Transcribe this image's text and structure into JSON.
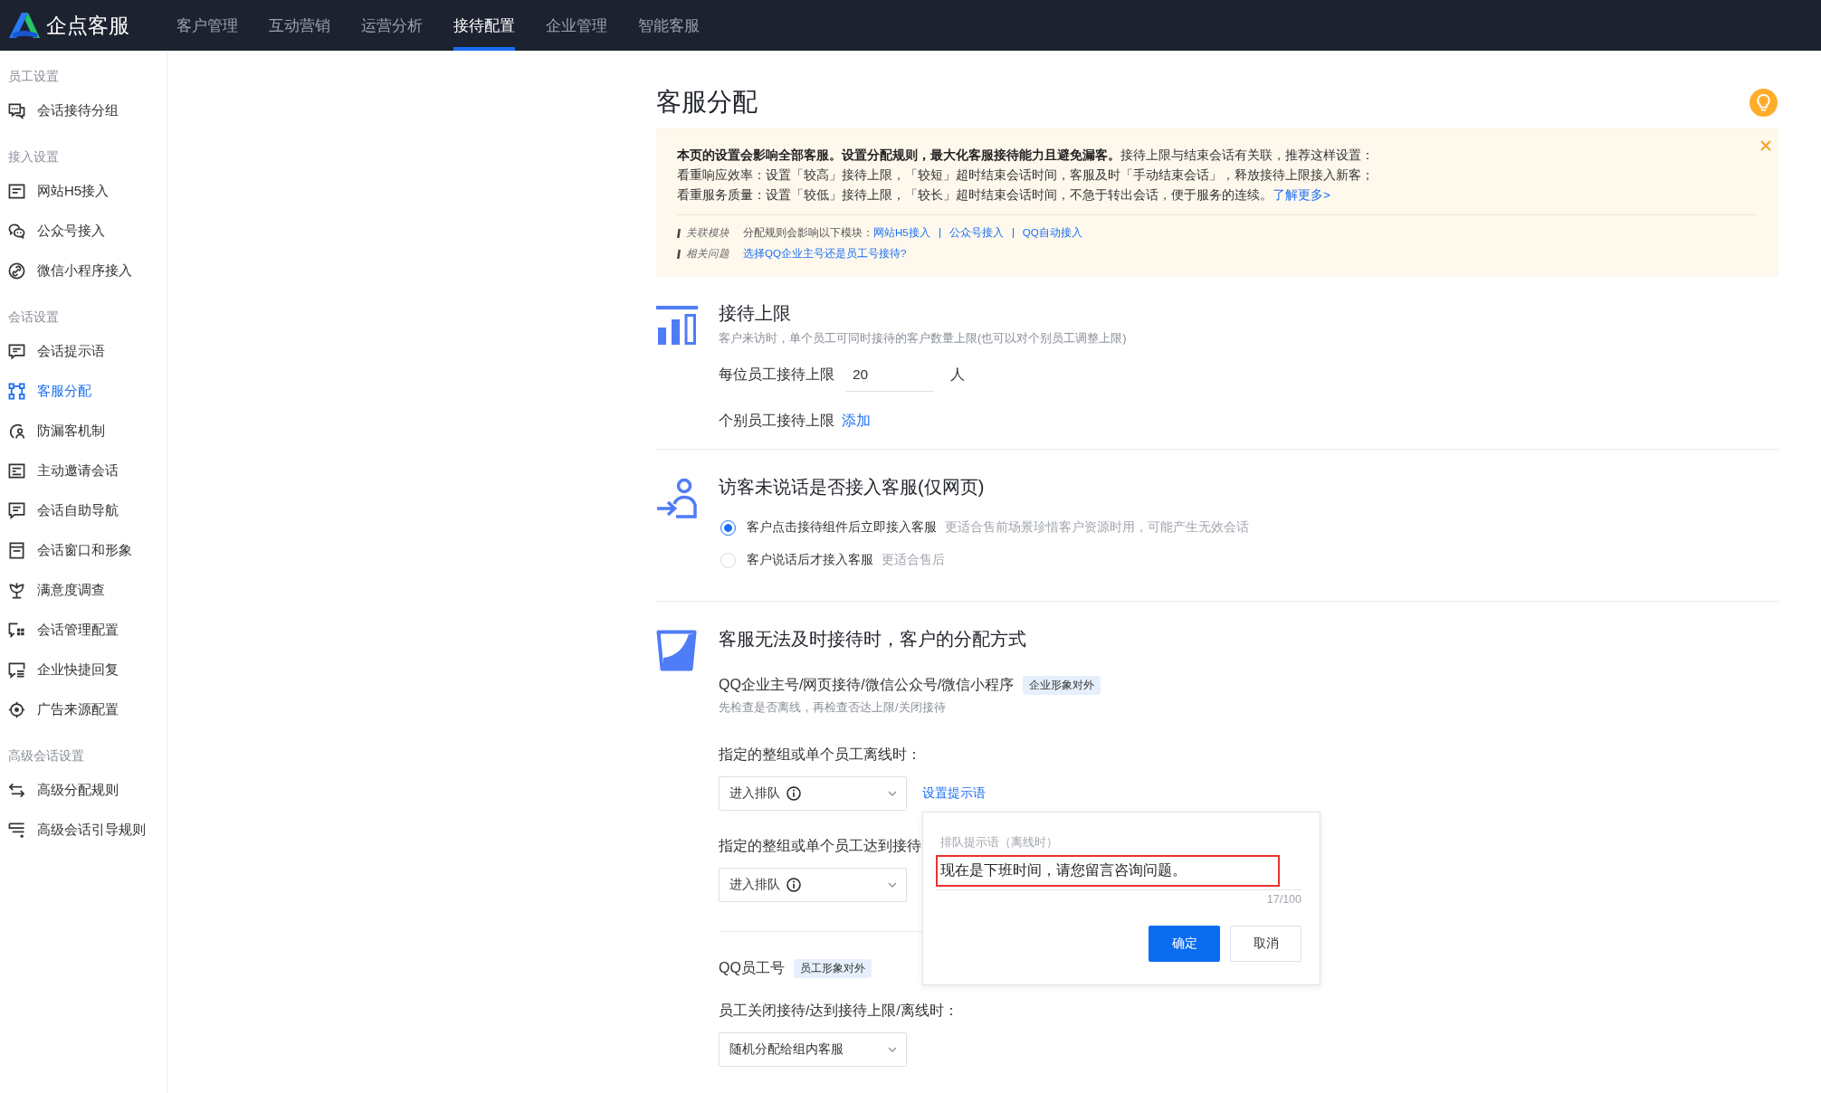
{
  "top_nav": {
    "logo_text": "企点客服",
    "items": [
      {
        "label": "客户管理",
        "selected": false
      },
      {
        "label": "互动营销",
        "selected": false
      },
      {
        "label": "运营分析",
        "selected": false
      },
      {
        "label": "接待配置",
        "selected": true
      },
      {
        "label": "企业管理",
        "selected": false
      },
      {
        "label": "智能客服",
        "selected": false
      }
    ]
  },
  "sidebar": {
    "groups": [
      {
        "title": "员工设置",
        "items": [
          {
            "label": "会话接待分组",
            "selected": false
          }
        ]
      },
      {
        "title": "接入设置",
        "items": [
          {
            "label": "网站H5接入",
            "selected": false
          },
          {
            "label": "公众号接入",
            "selected": false
          },
          {
            "label": "微信小程序接入",
            "selected": false
          }
        ]
      },
      {
        "title": "会话设置",
        "items": [
          {
            "label": "会话提示语",
            "selected": false
          },
          {
            "label": "客服分配",
            "selected": true
          },
          {
            "label": "防漏客机制",
            "selected": false
          },
          {
            "label": "主动邀请会话",
            "selected": false
          },
          {
            "label": "会话自助导航",
            "selected": false
          },
          {
            "label": "会话窗口和形象",
            "selected": false
          },
          {
            "label": "满意度调查",
            "selected": false
          },
          {
            "label": "会话管理配置",
            "selected": false
          },
          {
            "label": "企业快捷回复",
            "selected": false
          },
          {
            "label": "广告来源配置",
            "selected": false
          }
        ]
      },
      {
        "title": "高级会话设置",
        "items": [
          {
            "label": "高级分配规则",
            "selected": false
          },
          {
            "label": "高级会话引导规则",
            "selected": false
          }
        ]
      }
    ]
  },
  "page": {
    "title": "客服分配"
  },
  "notice": {
    "lines": [
      "**本页的设置会影响全部客服。设置分配规则，最大化客服接待能力且避免漏客。**接待上限与结束会话有关联，推荐这样设置：",
      "看重响应效率：设置「较高」接待上限，「较短」超时结束会话时间，客服及时「手动结束会话」，释放接待上限接入新客；",
      "看重服务质量：设置「较低」接待上限，「较长」超时结束会话时间，不急于转出会话，便于服务的连续。"
    ],
    "more_link": "了解更多>",
    "related": [
      {
        "label": "关联模块",
        "text": "分配规则会影响以下模块：",
        "links": [
          "网站H5接入",
          "公众号接入",
          "QQ自动接入"
        ]
      },
      {
        "label": "相关问题",
        "links": [
          "选择QQ企业主号还是员工号接待?"
        ]
      }
    ]
  },
  "limit_section": {
    "title": "接待上限",
    "description": "客户来访时，单个员工可同时接待的客户数量上限(也可以对个别员工调整上限)",
    "per_staff": {
      "label": "每位员工接待上限",
      "value": "20",
      "unit": "人"
    },
    "individual": {
      "label": "个别员工接待上限",
      "link": "添加"
    }
  },
  "visitor_section": {
    "title": "访客未说话是否接入客服(仅网页)",
    "options": [
      {
        "label": "客户点击接待组件后立即接入客服",
        "hint": "更适合售前场景珍惜客户资源时用，可能产生无效会话",
        "selected": true
      },
      {
        "label": "客户说话后才接入客服",
        "hint": "更适合售后",
        "selected": false
      }
    ]
  },
  "assign_section": {
    "title": "客服无法及时接待时，客户的分配方式",
    "groups": [
      {
        "title": "QQ企业主号/网页接待/微信公众号/微信小程序",
        "tag": "企业形象对外",
        "description": "先检查是否离线，再检查否达上限/关闭接待",
        "rules": [
          {
            "label": "指定的整组或单个员工离线时：",
            "select": "进入排队",
            "info": true,
            "link": "设置提示语",
            "popover": {
              "label": "排队提示语（离线时）",
              "value": "现在是下班时间，请您留言咨询问题。",
              "highlighted": true,
              "counter": "17/100",
              "buttons": [
                {
                  "label": "确定",
                  "kind": "primary"
                },
                {
                  "label": "取消",
                  "kind": "default"
                }
              ]
            }
          },
          {
            "label": "指定的整组或单个员工达到接待",
            "select": "进入排队",
            "info": true
          }
        ]
      },
      {
        "title": "QQ员工号",
        "tag": "员工形象对外",
        "rules": [
          {
            "label": "员工关闭接待/达到接待上限/离线时：",
            "select": "随机分配给组内客服",
            "info": false
          }
        ]
      }
    ]
  }
}
